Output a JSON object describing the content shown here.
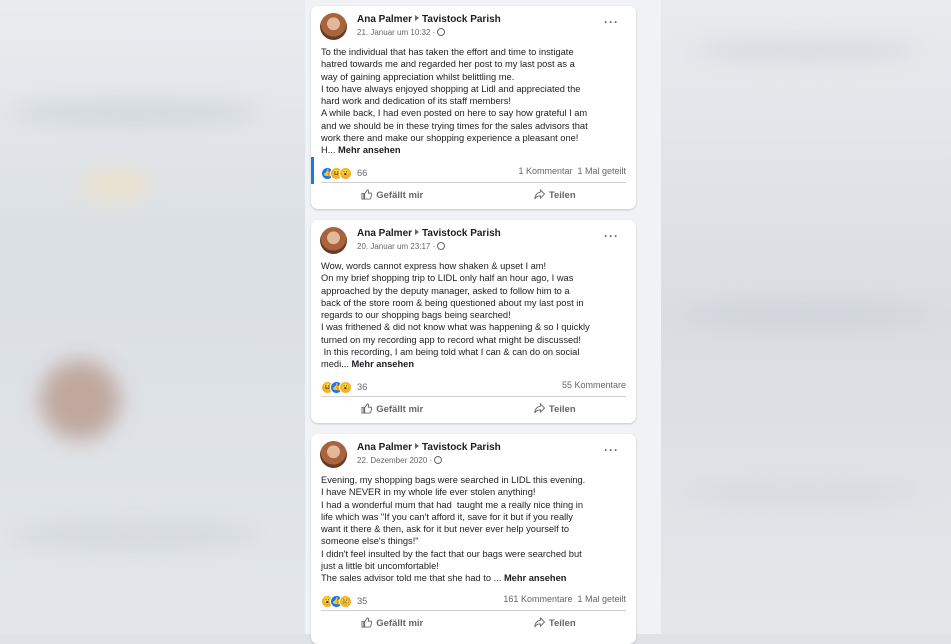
{
  "posts": [
    {
      "author": "Ana Palmer",
      "group": "Tavistock Parish",
      "date": "21. Januar um 10:32 ·",
      "text": "To the individual that has taken the effort and time to instigate\nhatred towards me and regarded her post to my last post as a\nway of gaining appreciation whilst belittling me.\nI too have always enjoyed shopping at Lidl and appreciated the\nhard work and dedication of its staff members!\nA while back, I had even posted on here to say how grateful I am\nand we should be in these trying times for the sales advisors that\nwork there and make our shopping experience a pleasant one!\nH... ",
      "more": "Mehr ansehen",
      "reactions": [
        "like",
        "haha",
        "wow"
      ],
      "reaction_count": "66",
      "comments": "1 Kommentar",
      "shares": "1 Mal geteilt"
    },
    {
      "author": "Ana Palmer",
      "group": "Tavistock Parish",
      "date": "20. Januar um 23:17 ·",
      "text": "Wow, words cannot express how shaken & upset I am!\nOn my brief shopping trip to LIDL only half an hour ago, I was\napproached by the deputy manager, asked to follow him to a\nback of the store room & being questioned about my last post in\nregards to our shopping bags being searched!\nI was frithened & did not know what was happening & so I quickly\nturned on my recording app to record what might be discussed!\n In this recording, I am being told what I can & can do on social\nmedi... ",
      "more": "Mehr ansehen",
      "reactions": [
        "haha",
        "like",
        "wow"
      ],
      "reaction_count": "36",
      "comments": "55 Kommentare",
      "shares": ""
    },
    {
      "author": "Ana Palmer",
      "group": "Tavistock Parish",
      "date": "22. Dezember 2020 ·",
      "text": "Evening, my shopping bags were searched in LIDL this evening.\nI have NEVER in my whole life ever stolen anything!\nI had a wonderful mum that had  taught me a really nice thing in\nlife which was \"If you can't afford it, save for it but if you really\nwant it there & then, ask for it but never ever help yourself to\nsomeone else's things!\"\nI didn't feel insulted by the fact that our bags were searched but\njust a little bit uncomfortable!\nThe sales advisor told me that she had to ... ",
      "more": "Mehr ansehen",
      "reactions": [
        "wow",
        "like",
        "sad"
      ],
      "reaction_count": "35",
      "comments": "161 Kommentare",
      "shares": "1 Mal geteilt"
    }
  ],
  "actions": {
    "like_label": "Gefällt mir",
    "share_label": "Teilen"
  },
  "icons": {
    "menu": "more-options-icon",
    "privacy": "globe-icon",
    "like": "thumbs-up-icon",
    "share": "share-arrow-icon"
  },
  "colors": {
    "accent": "#1877f2",
    "text_secondary": "#65676b"
  }
}
